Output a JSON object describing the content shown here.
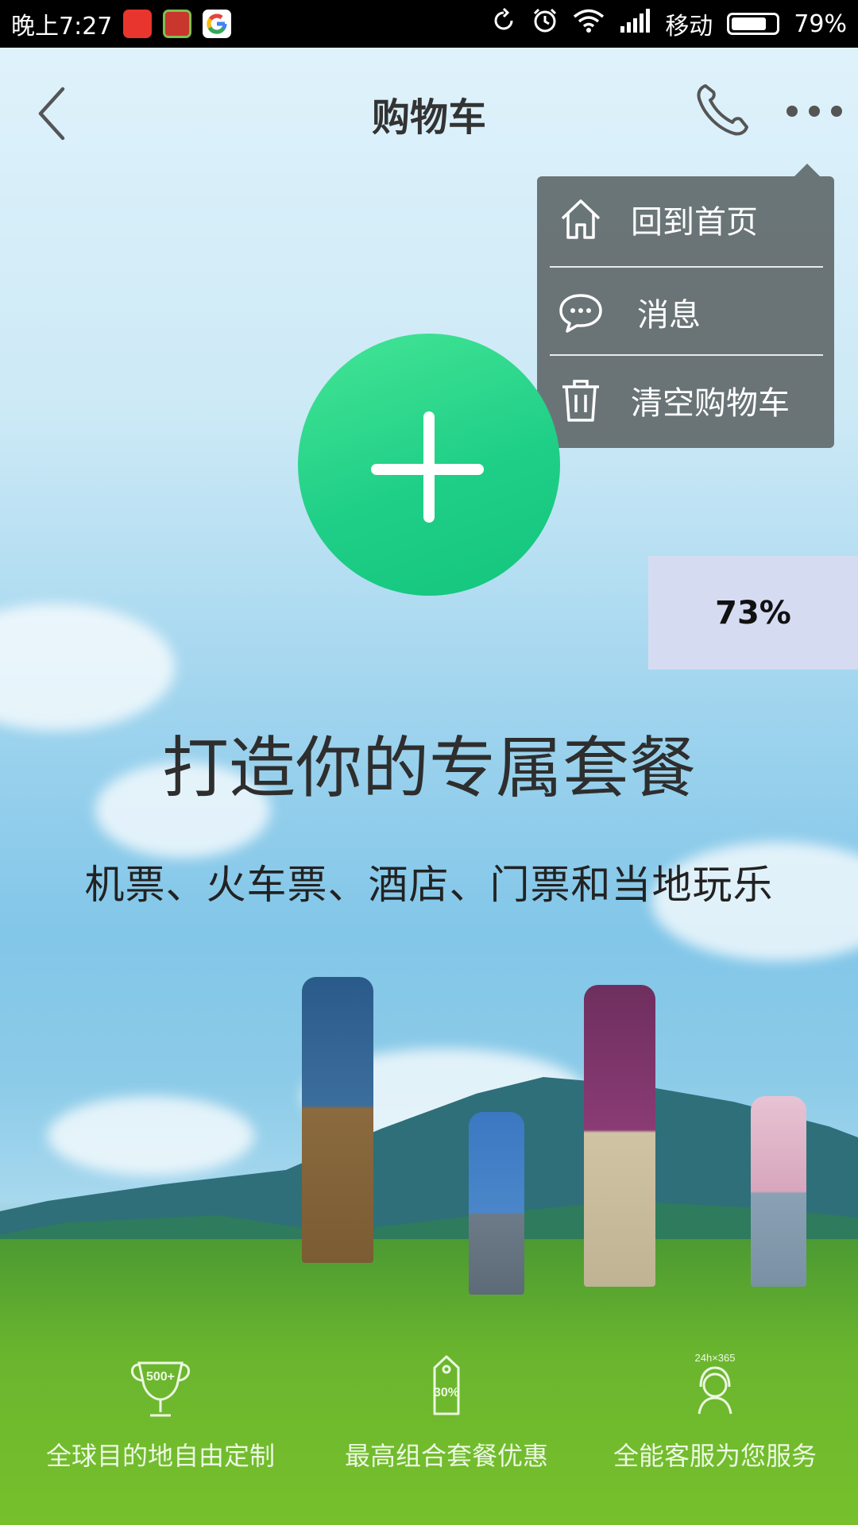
{
  "status_bar": {
    "time": "晚上7:27",
    "carrier": "移动",
    "battery_percent": "79%",
    "battery_level": 0.79,
    "icons": [
      "sync-icon",
      "alarm-icon",
      "wifi-icon",
      "signal-icon",
      "battery-icon"
    ]
  },
  "header": {
    "title": "购物车",
    "back_icon": "chevron-left-icon",
    "phone_icon": "phone-icon",
    "more_icon": "more-dots-icon"
  },
  "menu": {
    "items": [
      {
        "label": "回到首页",
        "icon": "home-icon"
      },
      {
        "label": "消息",
        "icon": "chat-bubble-icon"
      },
      {
        "label": "清空购物车",
        "icon": "trash-icon"
      }
    ]
  },
  "main": {
    "add_button_icon": "plus-icon",
    "progress_badge": "73%",
    "headline": "打造你的专属套餐",
    "subline": "机票、火车票、酒店、门票和当地玩乐"
  },
  "features": [
    {
      "label": "全球目的地自由定制",
      "icon": "trophy-icon",
      "icon_text": "500+"
    },
    {
      "label": "最高组合套餐优惠",
      "icon": "price-tag-icon",
      "icon_text": "30%"
    },
    {
      "label": "全能客服为您服务",
      "icon": "support-agent-icon",
      "icon_text": "24h×365"
    }
  ],
  "colors": {
    "accent_green": "#20cf87",
    "menu_bg": "#646e70",
    "badge_bg": "#d5dcf2"
  }
}
